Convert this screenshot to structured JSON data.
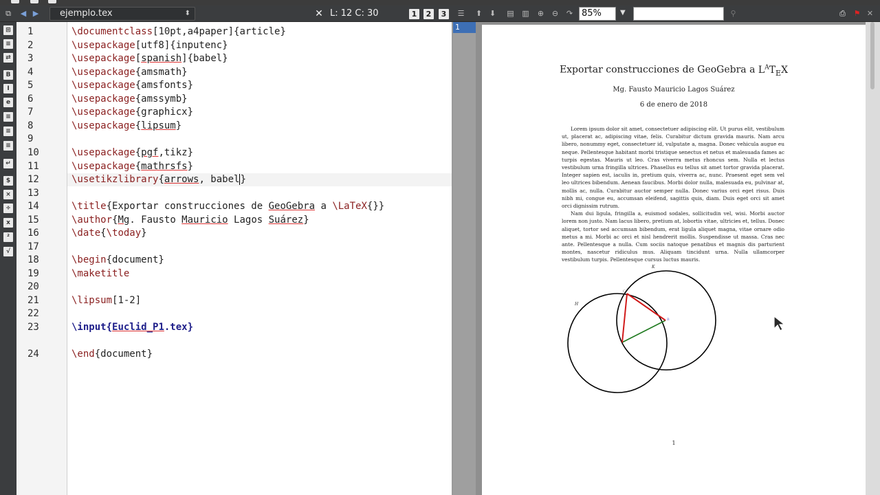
{
  "editor_tab": {
    "filename": "ejemplo.tex",
    "cursor_position": "L: 12 C: 30",
    "view_buttons": [
      "1",
      "2",
      "3"
    ]
  },
  "left_toolbar": {
    "icons": [
      "structure-icon",
      "bookmarks-icon",
      "labels-icon",
      "bold-icon",
      "italic-icon",
      "emph-icon",
      "align-left-icon",
      "align-center-icon",
      "align-right-icon",
      "newline-icon",
      "symbols-icon",
      "math-icon",
      "fraction-icon",
      "subscript-icon",
      "sqrt-icon"
    ]
  },
  "code_lines": [
    {
      "num": "1"
    },
    {
      "num": "2"
    },
    {
      "num": "3"
    },
    {
      "num": "4"
    },
    {
      "num": "5"
    },
    {
      "num": "6"
    },
    {
      "num": "7"
    },
    {
      "num": "8"
    },
    {
      "num": "9"
    },
    {
      "num": "10"
    },
    {
      "num": "11"
    },
    {
      "num": "12"
    },
    {
      "num": "13"
    },
    {
      "num": "14"
    },
    {
      "num": "15"
    },
    {
      "num": "16"
    },
    {
      "num": "17"
    },
    {
      "num": "18"
    },
    {
      "num": "19"
    },
    {
      "num": "20"
    },
    {
      "num": "21"
    },
    {
      "num": "22"
    },
    {
      "num": "23"
    },
    {
      "num": "24"
    }
  ],
  "code": {
    "l1": {
      "cmd": "\\documentclass",
      "rest": "[10pt,a4paper]{article}"
    },
    "l2": {
      "cmd": "\\usepackage",
      "rest": "[utf8]{inputenc}"
    },
    "l3": {
      "cmd": "\\usepackage",
      "pre": "[",
      "sq": "spanish",
      "post": "]{babel}"
    },
    "l4": {
      "cmd": "\\usepackage",
      "rest": "{amsmath}"
    },
    "l5": {
      "cmd": "\\usepackage",
      "rest": "{amsfonts}"
    },
    "l6": {
      "cmd": "\\usepackage",
      "rest": "{amssymb}"
    },
    "l7": {
      "cmd": "\\usepackage",
      "rest": "{graphicx}"
    },
    "l8": {
      "cmd": "\\usepackage",
      "pre": "{",
      "sq": "lipsum",
      "post": "}"
    },
    "l10": {
      "cmd": "\\usepackage",
      "pre": "{",
      "sq": "pgf",
      "post": ",tikz}"
    },
    "l11": {
      "cmd": "\\usepackage",
      "pre": "{",
      "sq": "mathrsfs",
      "post": "}"
    },
    "l12": {
      "cmd": "\\usetikzlibrary",
      "pre": "{",
      "sq": "arrows",
      "post": ", babel",
      "tail": "}"
    },
    "l14": {
      "cmd": "\\title",
      "a": "{Exportar construcciones de ",
      "sq": "GeoGebra",
      "b": " a ",
      "cmd2": "\\LaTeX",
      "c": "{}}"
    },
    "l15": {
      "cmd": "\\author",
      "pre": "{",
      "sq1": "Mg",
      "m1": ". Fausto ",
      "sq2": "Mauricio",
      "m2": " Lagos ",
      "sq3": "Suárez",
      "post": "}"
    },
    "l16": {
      "cmd": "\\date",
      "pre": "{",
      "cmd2": "\\today",
      "post": "}"
    },
    "l18": {
      "cmd": "\\begin",
      "rest": "{document}"
    },
    "l19": {
      "cmd": "\\maketitle"
    },
    "l21": {
      "cmd": "\\lipsum",
      "rest": "[1-2]"
    },
    "l23": {
      "cmd": "\\input",
      "pre": "{",
      "sq": "Euclid_P1",
      "post": ".tex}"
    },
    "l24": {
      "cmd": "\\end",
      "rest": "{document}"
    }
  },
  "viewer": {
    "zoom": "85%",
    "search_placeholder": "",
    "page_list": [
      "1"
    ]
  },
  "document": {
    "title": "Exportar construcciones de GeoGebra a LATEX",
    "title_main": "Exportar construcciones de GeoGebra a ",
    "latex_logo": "LATEX",
    "author": "Mg. Fausto Mauricio Lagos Suárez",
    "date": "6 de enero de 2018",
    "paragraph1": "Lorem ipsum dolor sit amet, consectetuer adipiscing elit. Ut purus elit, vestibulum ut, placerat ac, adipiscing vitae, felis. Curabitur dictum gravida mauris. Nam arcu libero, nonummy eget, consectetuer id, vulputate a, magna. Donec vehicula augue eu neque. Pellentesque habitant morbi tristique senectus et netus et malesuada fames ac turpis egestas. Mauris ut leo. Cras viverra metus rhoncus sem. Nulla et lectus vestibulum urna fringilla ultrices. Phasellus eu tellus sit amet tortor gravida placerat. Integer sapien est, iaculis in, pretium quis, viverra ac, nunc. Praesent eget sem vel leo ultrices bibendum. Aenean faucibus. Morbi dolor nulla, malesuada eu, pulvinar at, mollis ac, nulla. Curabitur auctor semper nulla. Donec varius orci eget risus. Duis nibh mi, congue eu, accumsan eleifend, sagittis quis, diam. Duis eget orci sit amet orci dignissim rutrum.",
    "paragraph2": "Nam dui ligula, fringilla a, euismod sodales, sollicitudin vel, wisi. Morbi auctor lorem non justo. Nam lacus libero, pretium at, lobortis vitae, ultricies et, tellus. Donec aliquet, tortor sed accumsan bibendum, erat ligula aliquet magna, vitae ornare odio metus a mi. Morbi ac orci et nisl hendrerit mollis. Suspendisse ut massa. Cras nec ante. Pellentesque a nulla. Cum sociis natoque penatibus et magnis dis parturient montes, nascetur ridiculus mus. Aliquam tincidunt urna. Nulla ullamcorper vestibulum turpis. Pellentesque cursus luctus mauris.",
    "figure_labels": {
      "h": "H",
      "k": "K",
      "c": "C",
      "b": "B"
    },
    "page_number": "1"
  },
  "colors": {
    "command": "#8a1f1f",
    "input_command": "#1f1f8a",
    "squiggle": "#dd3333",
    "triangle_red": "#d11a1a",
    "triangle_green": "#1f7a1f",
    "page_selected": "#3d6fb5"
  }
}
